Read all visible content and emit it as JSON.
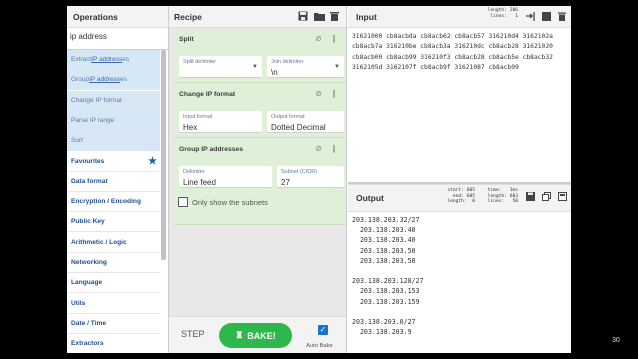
{
  "operations": {
    "title": "Operations",
    "search_value": "ip address",
    "results": [
      {
        "pre": "Extract ",
        "hl": "IP address",
        "post": "es"
      },
      {
        "pre": "Group ",
        "hl": "IP address",
        "post": "es"
      },
      {
        "pre": "Change IP format",
        "hl": "",
        "post": ""
      },
      {
        "pre": "Parse IP range",
        "hl": "",
        "post": ""
      },
      {
        "pre": "Sort",
        "hl": "",
        "post": ""
      }
    ],
    "categories": [
      "Favourites",
      "Data format",
      "Encryption / Encoding",
      "Public Key",
      "Arithmetic / Logic",
      "Networking",
      "Language",
      "Utils",
      "Date / Time",
      "Extractors"
    ]
  },
  "recipe": {
    "title": "Recipe",
    "split": {
      "title": "Split",
      "split_delimiter_label": "Split delimiter",
      "split_delimiter_value": "",
      "join_delimiter_label": "Join delimiter",
      "join_delimiter_value": "\\n"
    },
    "change_ip": {
      "title": "Change IP format",
      "input_label": "Input format",
      "input_value": "Hex",
      "output_label": "Output format",
      "output_value": "Dotted Decimal"
    },
    "group_ip": {
      "title": "Group IP addresses",
      "delimiter_label": "Delimiter",
      "delimiter_value": "Line feed",
      "subnet_label": "Subnet (CIDR)",
      "subnet_value": "27",
      "only_subnets_label": "Only show the subnets"
    },
    "step_label": "STEP",
    "bake_label": "BAKE!",
    "auto_bake_label": "Auto Bake"
  },
  "input": {
    "title": "Input",
    "meta": "length: 206\nlines:   1",
    "text": "31621000 cb8acbda cb8acb62 cb8acb57 316210d4 3162102a\ncb8acb7a 316210be cb8acb3a 316210dc cb8acb28 31621020\ncb8acb00 cb8acb99 316210f3 cb8acb28 cb8acb5e cb8acb32\n3162105d 3162107f cb8acb9f 31621087 cb8acb09"
  },
  "output": {
    "title": "Output",
    "meta1": "start: 605\n  end: 605\nlength:  0",
    "meta2": "time:   1ms\nlength: 603\nlines:   50",
    "text": "203.138.203.32/27\n  203.138.203.40\n  203.138.203.40\n  203.138.203.50\n  203.138.203.58\n\n203.138.203.128/27\n  203.138.203.153\n  203.138.203.159\n\n203.138.203.0/27\n  203.138.203.9"
  },
  "page_number": "30"
}
